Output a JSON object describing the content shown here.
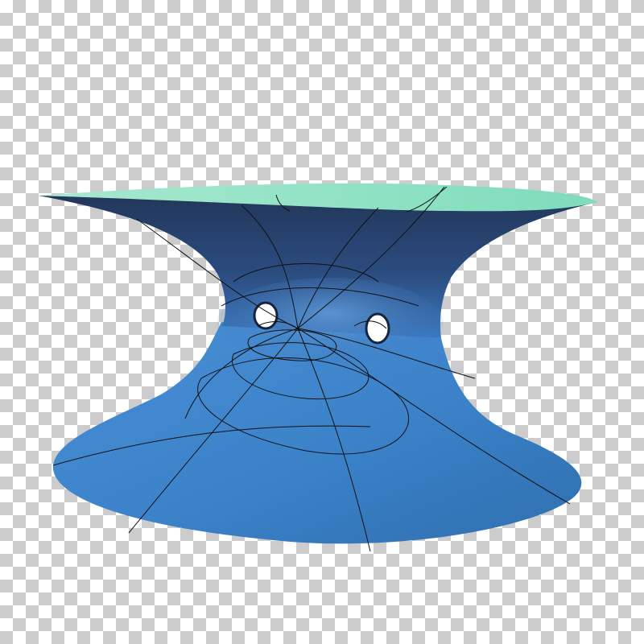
{
  "image": {
    "subject": "surface-render",
    "background": "transparency-checkerboard",
    "colors": {
      "checker_light": "#ffffff",
      "checker_dark": "#cccccc",
      "surface_outer": "#2f74b8",
      "surface_shadow": "#263e6a",
      "surface_inner_top": "#8ee3c4",
      "mesh_lines": "#101010"
    }
  }
}
